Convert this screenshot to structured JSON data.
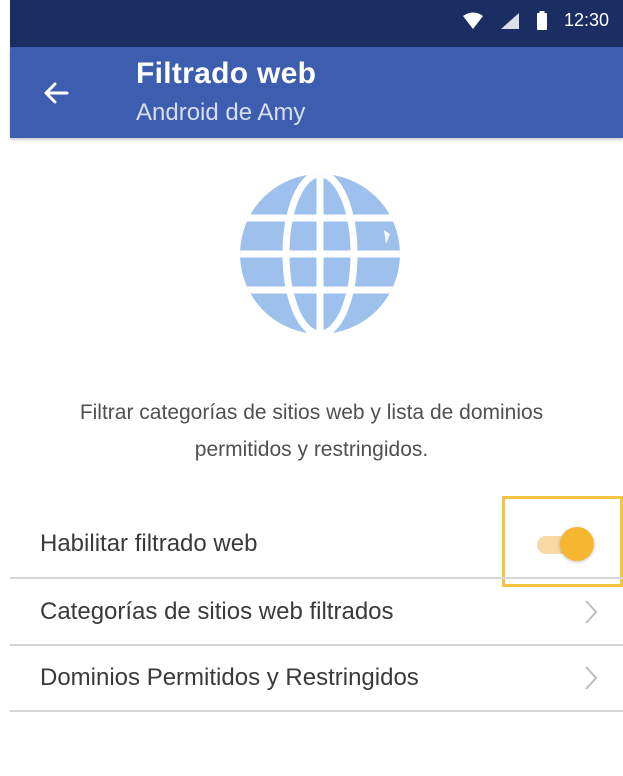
{
  "status_bar": {
    "time": "12:30",
    "icons": [
      "wifi-icon",
      "signal-icon",
      "battery-icon"
    ]
  },
  "app_bar": {
    "title": "Filtrado web",
    "subtitle": "Android de Amy",
    "back_icon": "arrow-left-icon"
  },
  "hero": {
    "icon": "globe-icon",
    "description_line1": "Filtrar categorías de sitios web y lista de dominios",
    "description_line2": "permitidos y restringidos."
  },
  "settings": {
    "enable_filter_label": "Habilitar filtrado web",
    "enable_filter_on": true,
    "categories_label": "Categorías de sitios web filtrados",
    "domains_label": "Dominios Permitidos y Restringidos"
  },
  "colors": {
    "status_bar": "#1b2e63",
    "app_bar": "#3d5eae",
    "globe": "#9dc1ec",
    "toggle_on": "#f7b630",
    "highlight": "#f5c542"
  }
}
